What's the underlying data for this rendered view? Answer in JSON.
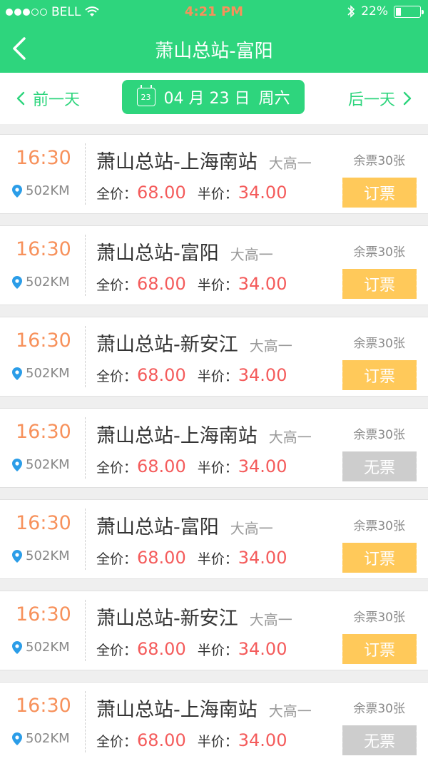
{
  "status_bar": {
    "carrier": "BELL",
    "time": "4:21 PM",
    "battery_percent": "22%",
    "battery_level": 0.22
  },
  "nav": {
    "title": "萧山总站-富阳",
    "back_icon": "chevron-left-icon"
  },
  "date_bar": {
    "prev_label": "前一天",
    "date_text": "04 月 23 日",
    "weekday": "周六",
    "calendar_day": "23",
    "next_label": "后一天"
  },
  "colors": {
    "primary": "#2ed57d",
    "time": "#f7915b",
    "price": "#f45b5b",
    "book_button": "#ffc95a",
    "sold_out_button": "#cdcdcd"
  },
  "labels": {
    "full_price": "全价：",
    "half_price": "半价："
  },
  "trips": [
    {
      "time": "16:30",
      "distance": "502KM",
      "route": "萧山总站-上海南站",
      "grade": "大高一",
      "full_price": "68.00",
      "half_price": "34.00",
      "remaining": "余票30张",
      "action": "订票",
      "available": true
    },
    {
      "time": "16:30",
      "distance": "502KM",
      "route": "萧山总站-富阳",
      "grade": "大高一",
      "full_price": "68.00",
      "half_price": "34.00",
      "remaining": "余票30张",
      "action": "订票",
      "available": true
    },
    {
      "time": "16:30",
      "distance": "502KM",
      "route": "萧山总站-新安江",
      "grade": "大高一",
      "full_price": "68.00",
      "half_price": "34.00",
      "remaining": "余票30张",
      "action": "订票",
      "available": true
    },
    {
      "time": "16:30",
      "distance": "502KM",
      "route": "萧山总站-上海南站",
      "grade": "大高一",
      "full_price": "68.00",
      "half_price": "34.00",
      "remaining": "余票30张",
      "action": "无票",
      "available": false
    },
    {
      "time": "16:30",
      "distance": "502KM",
      "route": "萧山总站-富阳",
      "grade": "大高一",
      "full_price": "68.00",
      "half_price": "34.00",
      "remaining": "余票30张",
      "action": "订票",
      "available": true
    },
    {
      "time": "16:30",
      "distance": "502KM",
      "route": "萧山总站-新安江",
      "grade": "大高一",
      "full_price": "68.00",
      "half_price": "34.00",
      "remaining": "余票30张",
      "action": "订票",
      "available": true
    },
    {
      "time": "16:30",
      "distance": "502KM",
      "route": "萧山总站-上海南站",
      "grade": "大高一",
      "full_price": "68.00",
      "half_price": "34.00",
      "remaining": "余票30张",
      "action": "无票",
      "available": false
    }
  ]
}
